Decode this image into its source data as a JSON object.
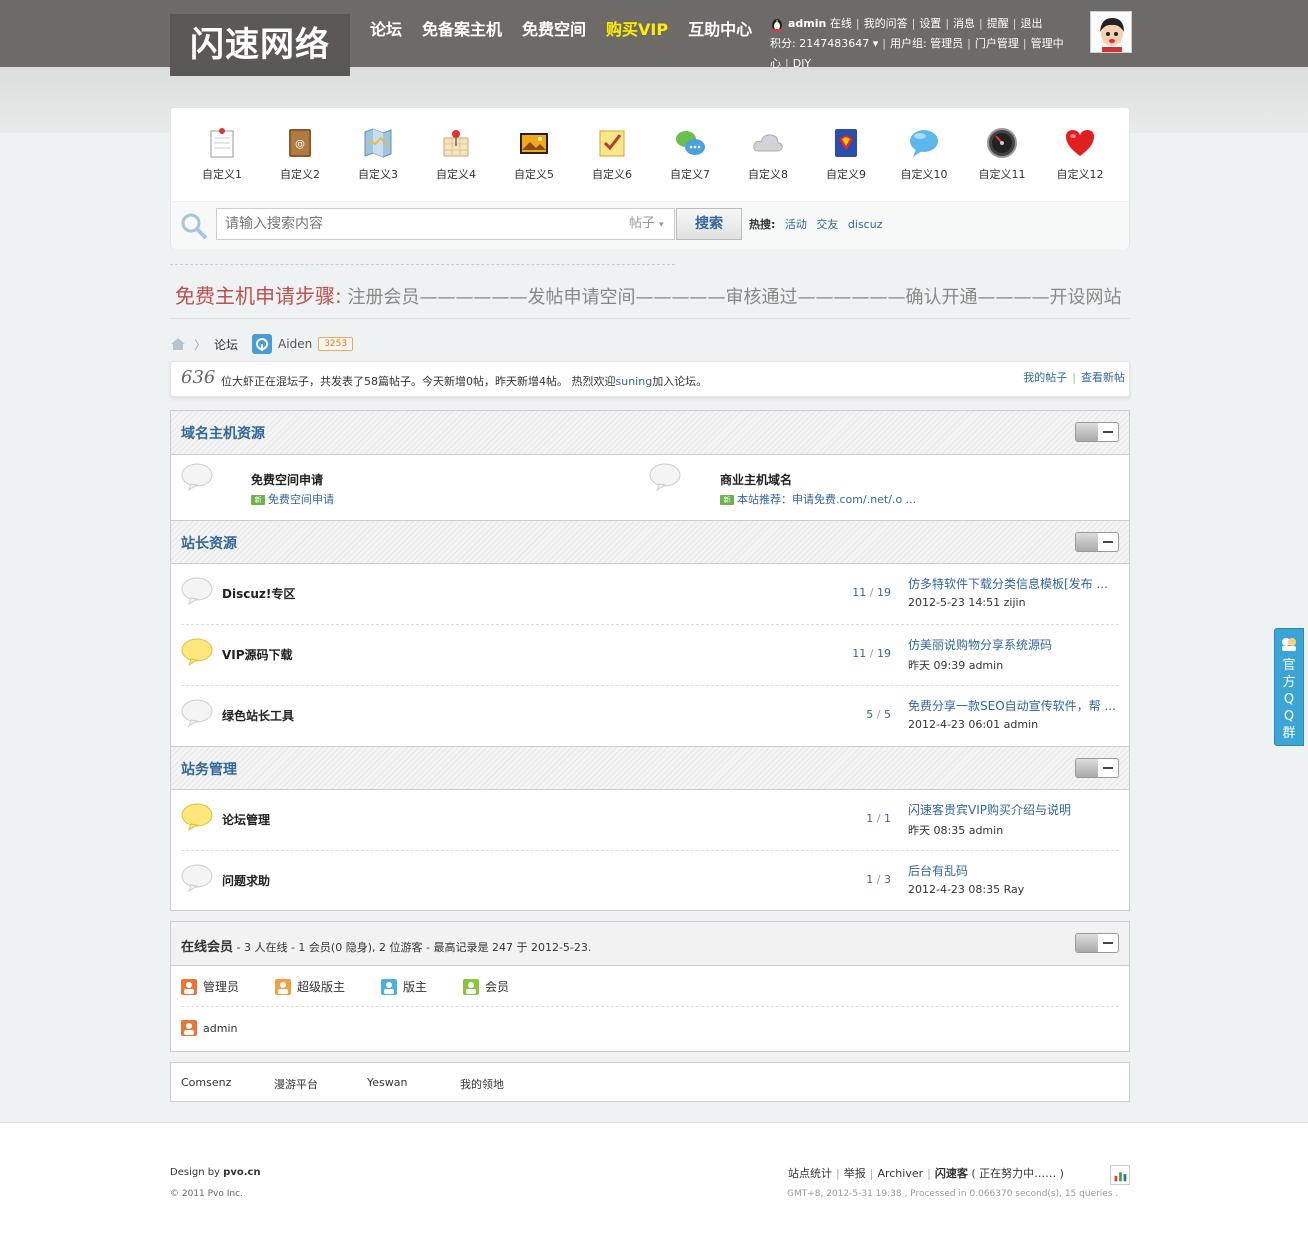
{
  "header": {
    "logo": "闪速网络",
    "nav": [
      {
        "label": "论坛"
      },
      {
        "label": "免备案主机"
      },
      {
        "label": "免费空间"
      },
      {
        "label": "购买VIP"
      },
      {
        "label": "互助中心"
      }
    ],
    "user": {
      "name": "admin",
      "status": "在线",
      "links": [
        "我的问答",
        "设置",
        "消息",
        "提醒",
        "退出"
      ],
      "points_label": "积分: 2147483647",
      "group_label": "用户组: 管理员",
      "links2": [
        "门户管理",
        "管理中心",
        "DIY"
      ]
    }
  },
  "quick_icons": [
    {
      "label": "自定义1",
      "icon": "notepad-icon"
    },
    {
      "label": "自定义2",
      "icon": "address-book-icon"
    },
    {
      "label": "自定义3",
      "icon": "map-icon"
    },
    {
      "label": "自定义4",
      "icon": "map-pin-icon"
    },
    {
      "label": "自定义5",
      "icon": "picture-icon"
    },
    {
      "label": "自定义6",
      "icon": "checklist-icon"
    },
    {
      "label": "自定义7",
      "icon": "chat-icon"
    },
    {
      "label": "自定义8",
      "icon": "cloud-icon"
    },
    {
      "label": "自定义9",
      "icon": "book-icon"
    },
    {
      "label": "自定义10",
      "icon": "speech-bubble-icon"
    },
    {
      "label": "自定义11",
      "icon": "gauge-icon"
    },
    {
      "label": "自定义12",
      "icon": "heart-icon"
    }
  ],
  "search": {
    "placeholder": "请输入搜索内容",
    "type": "帖子",
    "button": "搜索",
    "hot_label": "热搜:",
    "hot": [
      "活动",
      "交友",
      "discuz"
    ]
  },
  "steps_banner": {
    "head": "免费主机申请步骤:",
    "text": "注册会员——————发帖申请空间—————审核通过——————确认开通————开设网站"
  },
  "breadcrumb": {
    "root": "论坛",
    "user": "Aiden",
    "badge": "3253"
  },
  "stats": {
    "count": "636",
    "text": "位大虾正在混坛子，共发表了58篇帖子。今天新增0帖，昨天新增4帖。 热烈欢迎",
    "welcome_user": "suning",
    "text_end": "加入论坛。",
    "links": [
      "我的帖子",
      "查看新帖"
    ]
  },
  "categories": [
    {
      "title": "域名主机资源",
      "forums": [
        {
          "name": "免费空间申请",
          "newpost": "免费空间申请"
        },
        {
          "name": "商业主机域名",
          "newpost": "本站推荐：申请免费.com/.net/.o ..."
        }
      ]
    },
    {
      "title": "站长资源",
      "forums": [
        {
          "name": "Discuz!专区",
          "threads": "11",
          "posts": "19",
          "last_title": "仿多特软件下载分类信息模板[发布 ...",
          "last_time": "2012-5-23 14:51",
          "last_user": "zijin"
        },
        {
          "name": "VIP源码下载",
          "threads": "11",
          "posts": "19",
          "last_title": "仿美丽说购物分享系统源码",
          "last_time": "昨天 09:39",
          "last_user": "admin"
        },
        {
          "name": "绿色站长工具",
          "threads": "5",
          "posts": "5",
          "last_title": "免费分享一款SEO自动宣传软件，帮 ...",
          "last_time": "2012-4-23 06:01",
          "last_user": "admin"
        }
      ]
    },
    {
      "title": "站务管理",
      "forums": [
        {
          "name": "论坛管理",
          "threads": "1",
          "posts": "1",
          "last_title": "闪速客贵宾VIP购买介绍与说明",
          "last_time": "昨天 08:35",
          "last_user": "admin"
        },
        {
          "name": "问题求助",
          "threads": "1",
          "posts": "3",
          "last_title": "后台有乱码",
          "last_time": "2012-4-23 08:35",
          "last_user": "Ray"
        }
      ]
    }
  ],
  "online": {
    "title": "在线会员",
    "summary": " - 3 人在线 - 1 会员(0 隐身), 2 位游客 - 最高记录是 247 于 2012-5-23.",
    "legend": [
      {
        "label": "管理员",
        "color": "#e8763a"
      },
      {
        "label": "超级版主",
        "color": "#f0a040"
      },
      {
        "label": "版主",
        "color": "#4ab0e0"
      },
      {
        "label": "会员",
        "color": "#8cc43c"
      }
    ],
    "members": [
      "admin"
    ]
  },
  "friend_links": [
    "Comsenz",
    "漫游平台",
    "Yeswan",
    "我的领地"
  ],
  "footer": {
    "design_prefix": "Design by",
    "design_site": "pvo.cn",
    "copyright": "© 2011 Pvo Inc.",
    "links": [
      "站点统计",
      "举报",
      "Archiver",
      "闪速客"
    ],
    "extra": "( 正在努力中…… )",
    "gmt": "GMT+8, 2012-5-31 19:38 , Processed in 0.066370 second(s), 15 queries ."
  },
  "side_tab": "官方QQ群",
  "colors": {
    "topbar": "#6e6a68",
    "link": "#336699",
    "vip": "#ffee00"
  }
}
